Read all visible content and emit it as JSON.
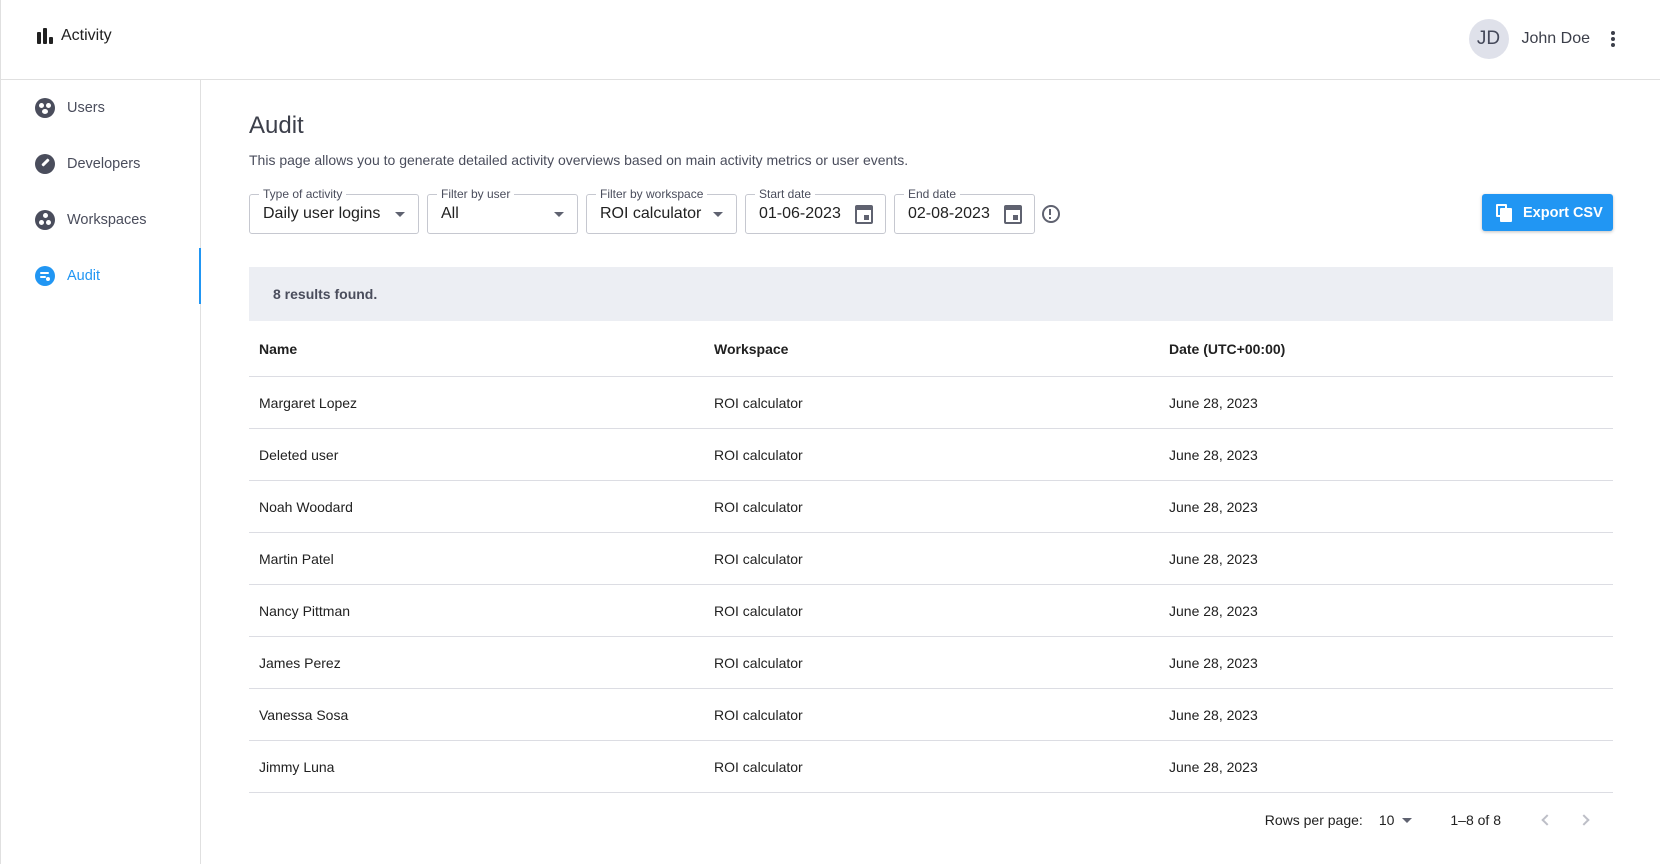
{
  "app": {
    "title": "Activity"
  },
  "user": {
    "initials": "JD",
    "name": "John Doe"
  },
  "sidebar": {
    "items": [
      {
        "label": "Users",
        "icon": "users-icon"
      },
      {
        "label": "Developers",
        "icon": "wrench-icon"
      },
      {
        "label": "Workspaces",
        "icon": "workspaces-icon"
      },
      {
        "label": "Audit",
        "icon": "audit-icon",
        "active": true
      }
    ]
  },
  "page": {
    "title": "Audit",
    "description": "This page allows you to generate detailed activity overviews based on main activity metrics or user events."
  },
  "filters": {
    "activity_type": {
      "label": "Type of activity",
      "value": "Daily user logins"
    },
    "user": {
      "label": "Filter by user",
      "value": "All"
    },
    "workspace": {
      "label": "Filter by workspace",
      "value": "ROI calculator"
    },
    "start_date": {
      "label": "Start date",
      "value": "01-06-2023"
    },
    "end_date": {
      "label": "End date",
      "value": "02-08-2023"
    }
  },
  "export_button": {
    "label": "Export CSV"
  },
  "results": {
    "summary": "8 results found."
  },
  "table": {
    "columns": [
      "Name",
      "Workspace",
      "Date (UTC+00:00)"
    ],
    "rows": [
      [
        "Margaret Lopez",
        "ROI calculator",
        "June 28, 2023"
      ],
      [
        "Deleted user",
        "ROI calculator",
        "June 28, 2023"
      ],
      [
        "Noah Woodard",
        "ROI calculator",
        "June 28, 2023"
      ],
      [
        "Martin Patel",
        "ROI calculator",
        "June 28, 2023"
      ],
      [
        "Nancy Pittman",
        "ROI calculator",
        "June 28, 2023"
      ],
      [
        "James Perez",
        "ROI calculator",
        "June 28, 2023"
      ],
      [
        "Vanessa Sosa",
        "ROI calculator",
        "June 28, 2023"
      ],
      [
        "Jimmy Luna",
        "ROI calculator",
        "June 28, 2023"
      ]
    ]
  },
  "pagination": {
    "rows_per_page_label": "Rows per page:",
    "rows_per_page": "10",
    "range": "1–8 of 8"
  },
  "colors": {
    "accent": "#2196f3",
    "results_bar": "#eceef3"
  }
}
